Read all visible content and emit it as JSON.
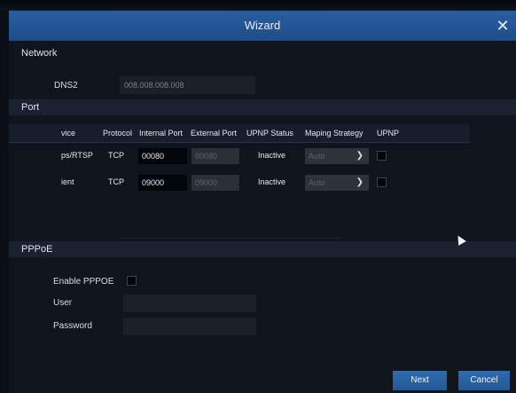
{
  "window": {
    "title": "Wizard",
    "close_icon": "close-icon"
  },
  "network": {
    "section_label": "Network",
    "dns2_label": "DNS2",
    "dns2_value": "008.008.008.008"
  },
  "port": {
    "section_label": "Port",
    "columns": [
      "vice",
      "Protocol",
      "Internal Port",
      "External Port",
      "UPNP Status",
      "Maping Strategy",
      "UPNP"
    ],
    "rows": [
      {
        "service": "ps/RTSP",
        "protocol": "TCP",
        "internal_port": "00080",
        "external_port": "00080",
        "upnp_status": "Inactive",
        "maping_strategy": "Auto",
        "upnp": false
      },
      {
        "service": "ient",
        "protocol": "TCP",
        "internal_port": "09000",
        "external_port": "09000",
        "upnp_status": "Inactive",
        "maping_strategy": "Auto",
        "upnp": false
      }
    ]
  },
  "pppoe": {
    "section_label": "PPPoE",
    "enable_label": "Enable PPPOE",
    "enable_checked": false,
    "user_label": "User",
    "user_value": "",
    "password_label": "Password",
    "password_value": ""
  },
  "buttons": {
    "next_label": "Next",
    "cancel_label": "Cancel"
  },
  "colors": {
    "title_bar": "#2a5ea0",
    "background": "#0f141d",
    "button": "#2f6bb0"
  }
}
